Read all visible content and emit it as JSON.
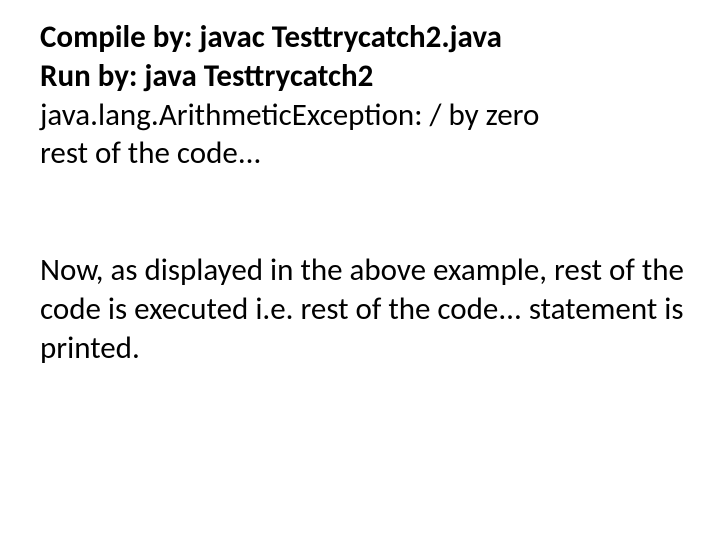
{
  "block1": {
    "line1_label": "Compile by:",
    "line1_value": " javac Testtrycatch2.java",
    "line2_label": "Run by:",
    "line2_value": " java Testtrycatch2",
    "line3": "java.lang.ArithmeticException: / by zero",
    "line4": "rest of the code..."
  },
  "block2": {
    "text": "Now, as displayed in the above example, rest of the code is executed i.e. rest of the code... statement is printed."
  }
}
